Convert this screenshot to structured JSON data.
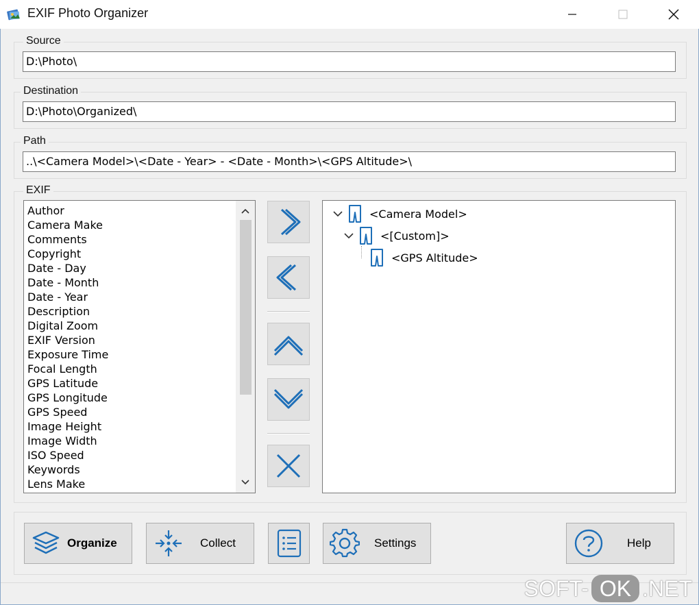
{
  "window": {
    "title": "EXIF Photo Organizer",
    "icon": "app-icon",
    "controls": [
      "minimize-icon",
      "maximize-icon",
      "close-icon"
    ]
  },
  "source": {
    "label": "Source",
    "value": "D:\\Photo\\"
  },
  "destination": {
    "label": "Destination",
    "value": "D:\\Photo\\Organized\\"
  },
  "path": {
    "label": "Path",
    "value": "..\\<Camera Model>\\<Date - Year> - <Date - Month>\\<GPS Altitude>\\"
  },
  "exif": {
    "label": "EXIF",
    "items": [
      "Author",
      "Camera Make",
      "Comments",
      "Copyright",
      "Date - Day",
      "Date - Month",
      "Date - Year",
      "Description",
      "Digital Zoom",
      "EXIF Version",
      "Exposure Time",
      "Focal Length",
      "GPS Latitude",
      "GPS Longitude",
      "GPS Speed",
      "Image Height",
      "Image Width",
      "ISO Speed",
      "Keywords",
      "Lens Make"
    ]
  },
  "tools": {
    "add": "chevron-right-icon",
    "remove": "chevron-left-icon",
    "up": "chevron-up-icon",
    "down": "chevron-down-icon",
    "delete": "close-icon"
  },
  "tree": {
    "nodes": [
      {
        "label": "<Camera Model>",
        "level": 0,
        "expanded": true
      },
      {
        "label": "<[Custom]>",
        "level": 1,
        "expanded": true
      },
      {
        "label": "<GPS Altitude>",
        "level": 2,
        "expanded": false
      }
    ]
  },
  "buttons": {
    "organize": "Organize",
    "collect": "Collect",
    "list_icon": "list-icon",
    "settings": "Settings",
    "help": "Help"
  },
  "watermark": {
    "left": "SOFT-",
    "pill": "OK",
    "right": ".NET"
  },
  "colors": {
    "accent": "#1e6fb8",
    "button_face": "#e1e1e1",
    "border": "#7a7a7a"
  }
}
